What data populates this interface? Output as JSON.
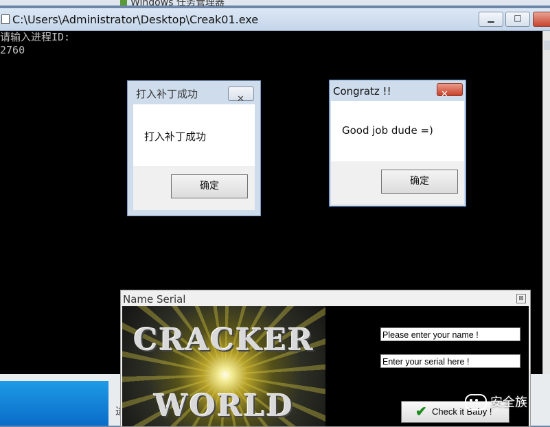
{
  "background": {
    "task_manager_title": "Windows 任务管理器",
    "bottom_glyph": "进"
  },
  "console": {
    "title": "C:\\Users\\Administrator\\Desktop\\Creak01.exe",
    "lines": [
      "请输入进程ID:",
      "2760"
    ]
  },
  "msgbox_patch": {
    "title": "打入补丁成功",
    "message": "打入补丁成功",
    "ok_label": "确定",
    "close_glyph": "✕"
  },
  "msgbox_congratz": {
    "title": "Congratz !!",
    "message": "Good job dude =)",
    "ok_label": "确定",
    "close_glyph": "✕"
  },
  "name_serial": {
    "title": "Name Serial",
    "close_glyph": "⊠",
    "banner_line1": "CRACKER",
    "banner_line2": "WORLD",
    "name_field_value": "Please enter your name !",
    "serial_field_value": "Enter your serial here !",
    "check_button_label": "Check it Baby !"
  },
  "watermark": {
    "text": "安全族"
  },
  "icons": {
    "check": "check-icon",
    "wechat": "wechat-icon"
  }
}
